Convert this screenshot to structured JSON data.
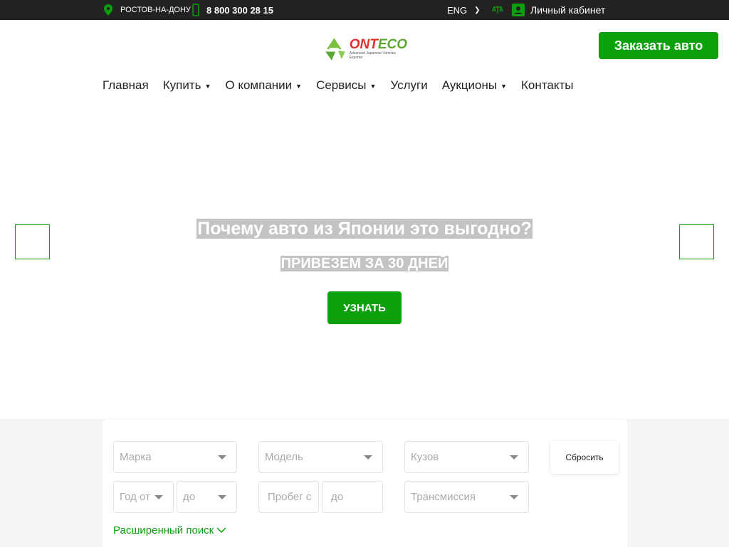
{
  "topbar": {
    "city": "РОСТОВ-НА-ДОНУ",
    "phone": "8 800 300 28 15",
    "lang": "ENG",
    "cabinet": "Личный кабинет"
  },
  "logo": {
    "brand": "ONTECO",
    "tagline": "Advanced Japanese Vehicles Exporter"
  },
  "header": {
    "order_label": "Заказать авто"
  },
  "nav": [
    {
      "label": "Главная",
      "dropdown": false
    },
    {
      "label": "Купить",
      "dropdown": true
    },
    {
      "label": "О компании",
      "dropdown": true
    },
    {
      "label": "Сервисы",
      "dropdown": true
    },
    {
      "label": "Услуги",
      "dropdown": false
    },
    {
      "label": "Аукционы",
      "dropdown": true
    },
    {
      "label": "Контакты",
      "dropdown": false
    }
  ],
  "hero": {
    "title": "Почему авто из Японии это выгодно?",
    "subtitle": "ПРИВЕЗЕМ ЗА 30 ДНЕЙ",
    "cta": "УЗНАТЬ"
  },
  "search": {
    "make": "Марка",
    "model": "Модель",
    "body": "Кузов",
    "year_from": "Год от",
    "year_to": "до",
    "mileage_from": "Пробег с",
    "mileage_to": "до",
    "transmission": "Трансмиссия",
    "reset": "Сбросить",
    "advanced": "Расширенный поиск"
  },
  "colors": {
    "accent": "#0ca10c",
    "topbar": "#222222"
  }
}
